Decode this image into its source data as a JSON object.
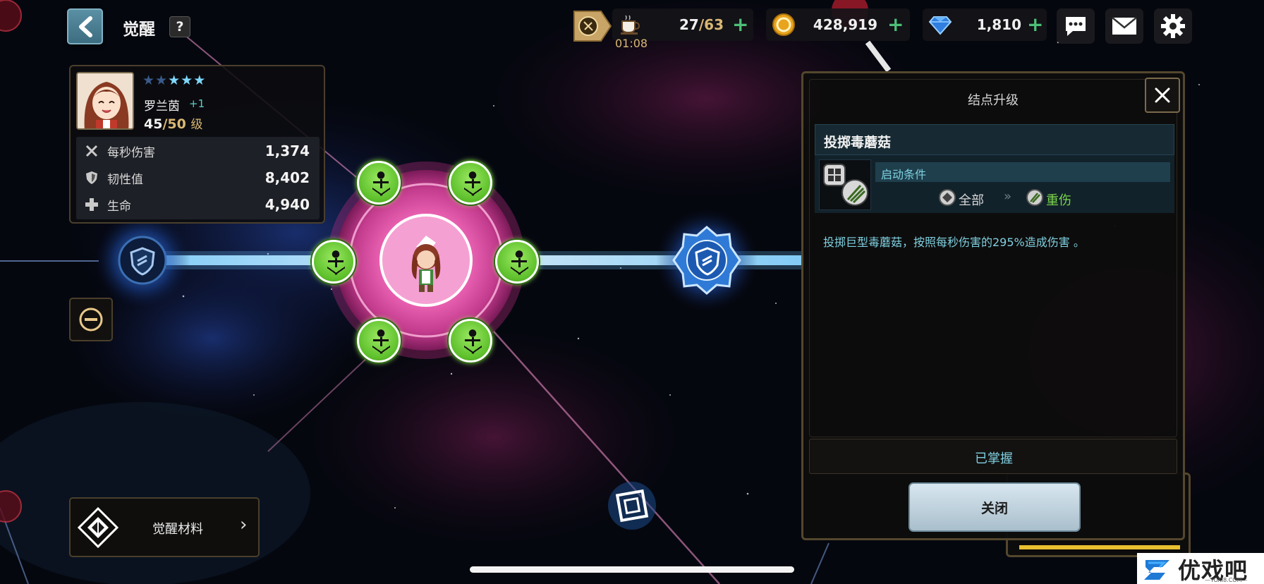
{
  "header": {
    "title": "觉醒",
    "help_label": "?"
  },
  "character": {
    "name": "罗兰茵",
    "bonus": "+1",
    "level": "45",
    "level_max": "/50",
    "level_unit": "级",
    "stars_total": 5,
    "stars_filled": 3,
    "stats": [
      {
        "label": "每秒伤害",
        "value": "1,374",
        "icon": "crossed-swords-icon"
      },
      {
        "label": "韧性值",
        "value": "8,402",
        "icon": "shield-icon"
      },
      {
        "label": "生命",
        "value": "4,940",
        "icon": "plus-icon"
      }
    ]
  },
  "resources": {
    "stamina_current": "27",
    "stamina_max": "/63",
    "stamina_timer": "01:08",
    "gold": "428,919",
    "gems": "1,810"
  },
  "awaken_material": {
    "label": "觉醒材料"
  },
  "panel": {
    "title": "结点升级",
    "skill_name": "投掷毒蘑菇",
    "condition_label": "启动条件",
    "condition_from": "全部",
    "condition_arrow": "»",
    "condition_to": "重伤",
    "description": "投掷巨型毒蘑菇，按照每秒伤害的295%造成伤害 。",
    "status": "已掌握",
    "close_label": "关闭"
  },
  "watermark": {
    "text": "优戏吧",
    "url": "—YOXI8.COM—"
  },
  "colors": {
    "accent_teal": "#7fd0e0",
    "gold_text": "#d9b873",
    "green_plus": "#4dbf77",
    "node_green": "#6fcf3a",
    "panel_border": "#54472d"
  }
}
